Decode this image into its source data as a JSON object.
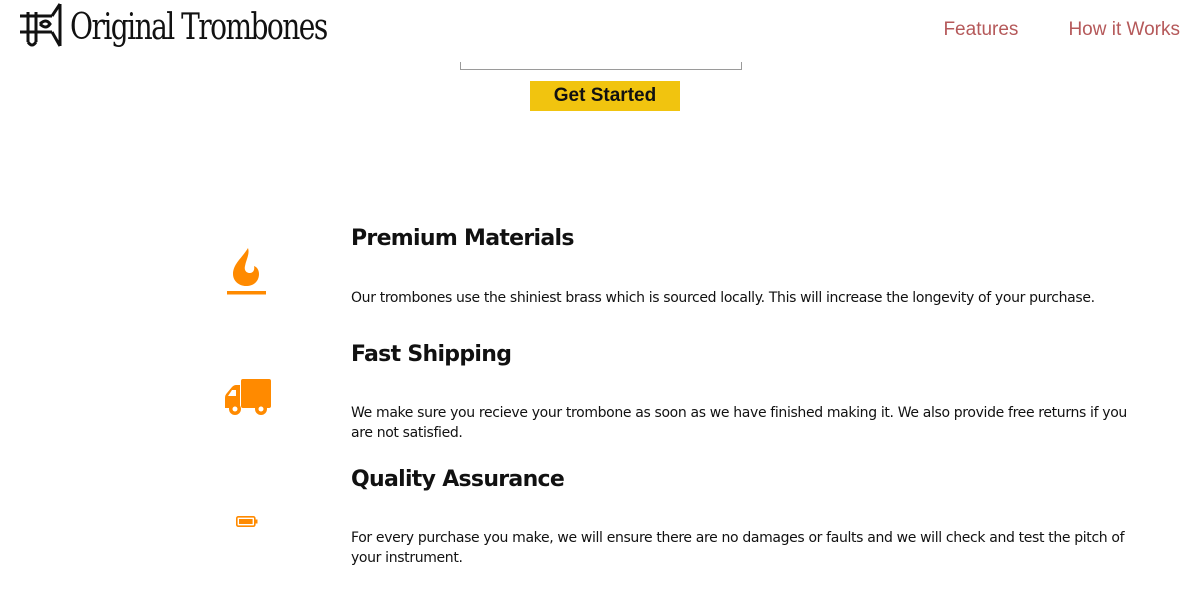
{
  "header": {
    "brand": "Original Trombones",
    "nav": [
      {
        "label": "Features"
      },
      {
        "label": "How it Works"
      }
    ]
  },
  "signup": {
    "email_value": "",
    "cta_label": "Get Started"
  },
  "features": [
    {
      "icon": "fire-icon",
      "title": "Premium Materials",
      "description": "Our trombones use the shiniest brass which is sourced locally. This will increase the longevity of your purchase."
    },
    {
      "icon": "truck-icon",
      "title": "Fast Shipping",
      "description": "We make sure you recieve your trombone as soon as we have finished making it. We also provide free returns if you are not satisfied."
    },
    {
      "icon": "battery-icon",
      "title": "Quality Assurance",
      "description": "For every purchase you make, we will ensure there are no damages or faults and we will check and test the pitch of your instrument."
    }
  ],
  "colors": {
    "icon_orange": "#ff8a00",
    "nav_link": "#b5595a",
    "cta_yellow": "#f1c40f"
  }
}
